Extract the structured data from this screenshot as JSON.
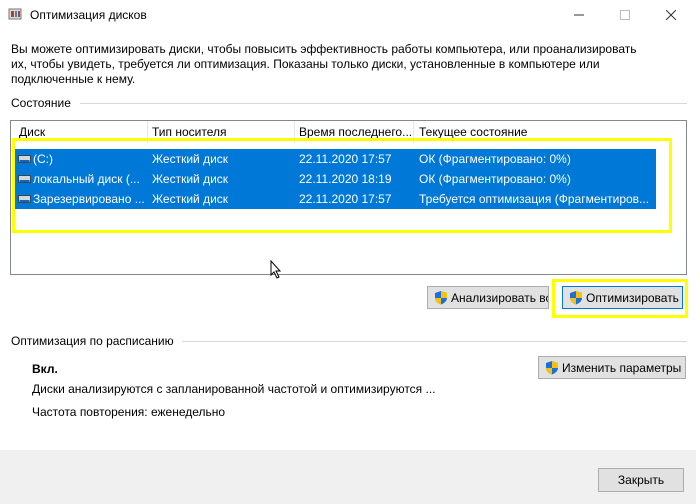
{
  "window": {
    "title": "Оптимизация дисков",
    "app_icon": "defrag-app-icon",
    "minimize_icon": "minimize-icon",
    "maximize_icon": "maximize-icon",
    "close_icon": "close-icon"
  },
  "intro": {
    "text": "Вы можете оптимизировать диски, чтобы повысить эффективность работы  компьютера, или проанализировать их, чтобы увидеть, требуется ли оптимизация. Показаны только диски, установленные в компьютере или подключенные к нему."
  },
  "status": {
    "label": "Состояние",
    "columns": [
      "Диск",
      "Тип носителя",
      "Время последнего...",
      "Текущее состояние"
    ],
    "rows": [
      {
        "drive": "(C:)",
        "media": "Жесткий диск",
        "last_run": "22.11.2020 17:57",
        "state": "ОК (Фрагментировано: 0%)"
      },
      {
        "drive": "локальный диск (...",
        "media": "Жесткий диск",
        "last_run": "22.11.2020 18:19",
        "state": "ОК (Фрагментировано: 0%)"
      },
      {
        "drive": "Зарезервировано ...",
        "media": "Жесткий диск",
        "last_run": "22.11.2020 17:57",
        "state": "Требуется оптимизация (Фрагментиров..."
      }
    ],
    "row_icon": "hard-drive-icon",
    "selection_color": "#0078d7"
  },
  "actions": {
    "analyze_all": "Анализировать все",
    "optimize_all": "Оптимизировать все",
    "shield_icon": "uac-shield-icon"
  },
  "schedule": {
    "label": "Оптимизация по расписанию",
    "state": "Вкл.",
    "description": "Диски анализируются с запланированной частотой и оптимизируются ...",
    "frequency": "Частота повторения: еженедельно",
    "change_settings": "Изменить параметры"
  },
  "footer": {
    "close_label": "Закрыть"
  },
  "annotations": {
    "highlight_color": "#ffff00"
  }
}
